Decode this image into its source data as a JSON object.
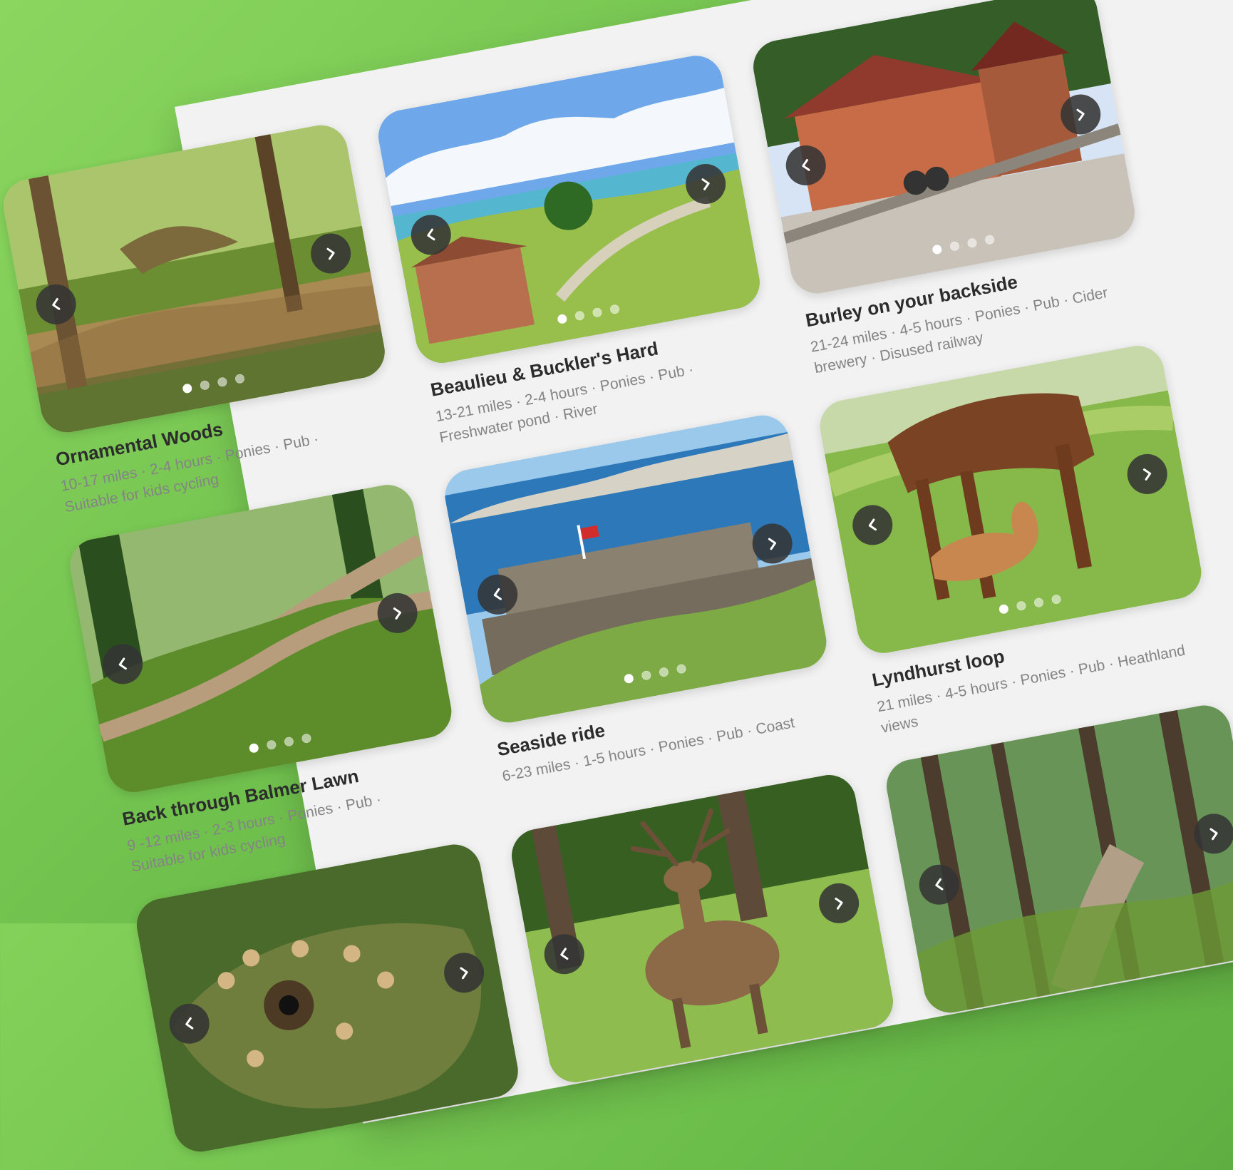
{
  "cards": [
    {
      "title": "Ornamental Woods",
      "meta": [
        "10-17 miles",
        "2-4 hours",
        "Ponies",
        "Pub",
        "Suitable for kids cycling"
      ],
      "theme": "forest-river",
      "colors": {
        "sky": "#d8e7c1",
        "top": "#aac56b",
        "mid": "#6c8e33",
        "water": "#a88a52",
        "ground": "#5f7431",
        "trees": "#7c6a3d"
      }
    },
    {
      "title": "Beaulieu & Buckler's Hard",
      "meta": [
        "13-21 miles",
        "2-4 hours",
        "Ponies",
        "Pub",
        "Freshwater pond",
        "River"
      ],
      "theme": "harbour",
      "colors": {
        "sky": "#6ea8ea",
        "clouds": "#f4f7fb",
        "water": "#55b6cf",
        "grass": "#98be4b",
        "roof": "#8d4b33",
        "house": "#b86f4e"
      }
    },
    {
      "title": "Burley on your backside",
      "meta": [
        "21-24 miles",
        "4-5 hours",
        "Ponies",
        "Pub",
        "Cider brewery",
        "Disused railway"
      ],
      "theme": "village",
      "colors": {
        "sky": "#d6e4f5",
        "trees": "#355d27",
        "building": "#c76c46",
        "roof": "#8f3a2d",
        "street": "#c9c2b8"
      }
    },
    {
      "title": "Back through Balmer Lawn",
      "meta": [
        "9 -12 miles",
        "2-3 hours",
        "Ponies",
        "Pub",
        "Suitable for kids cycling"
      ],
      "theme": "woodland-path",
      "colors": {
        "light": "#cfe8a6",
        "trees": "#4d7e2f",
        "dark": "#2a4e1e",
        "path": "#b79d7b",
        "fern": "#5d8c2b"
      }
    },
    {
      "title": "Seaside ride",
      "meta": [
        "6-23 miles",
        "1-5 hours",
        "Ponies",
        "Pub",
        "Coast"
      ],
      "theme": "coast",
      "colors": {
        "sky": "#9ac9ec",
        "sea": "#2d78b9",
        "stone": "#8b8170",
        "grass": "#7daa44",
        "cliff": "#d7d2c6"
      }
    },
    {
      "title": "Lyndhurst loop",
      "meta": [
        "21 miles",
        "4-5 hours",
        "Ponies",
        "Pub",
        "Heathland views"
      ],
      "theme": "ponies",
      "colors": {
        "grass": "#86b94a",
        "field": "#aacd67",
        "horse": "#7a4323",
        "foal": "#c8874f",
        "sky": "#c7d8a9"
      }
    },
    {
      "title": "",
      "meta": [],
      "theme": "lizard",
      "colors": {
        "base": "#6f7d3d",
        "scale": "#d4b685",
        "dark": "#4d3a24",
        "bg": "#4a6a2b"
      }
    },
    {
      "title": "",
      "meta": [],
      "theme": "deer",
      "colors": {
        "grass": "#8ebc4f",
        "trees": "#375f21",
        "bark": "#5e4a39",
        "deer": "#8c6a48"
      }
    },
    {
      "title": "",
      "meta": [],
      "theme": "forest-track",
      "colors": {
        "trees": "#35672b",
        "light": "#b5d79b",
        "path": "#b19f88",
        "fern": "#6b9a34"
      }
    }
  ]
}
